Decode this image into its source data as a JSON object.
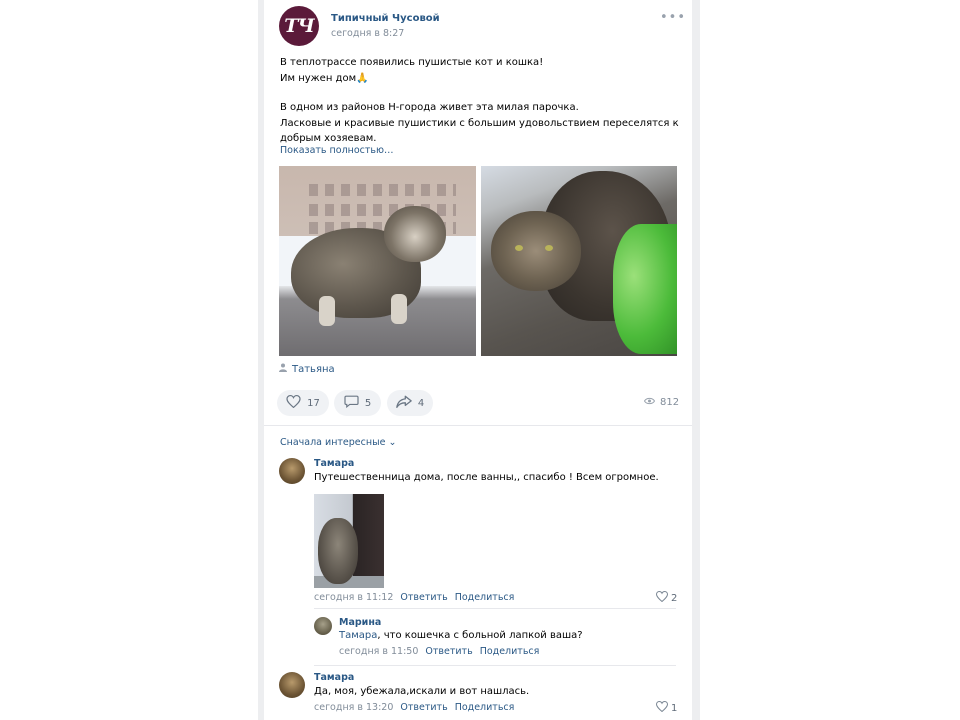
{
  "group": {
    "avatar_text": "ТЧ",
    "name": "Типичный Чусовой",
    "time": "сегодня в 8:27",
    "more": "•••"
  },
  "post": {
    "line1": "В теплотрассе появились пушистые кот и кошка!",
    "line2": "Им нужен дом🙏",
    "line3": "В одном из районов Н-города живет эта милая парочка.",
    "line4": "Ласковые и красивые пушистики с большим удовольствием переселятся к",
    "line5": "добрым хозяевам.",
    "show_more": "Показать полностью…",
    "author": "Татьяна"
  },
  "actions": {
    "likes": "17",
    "comments": "5",
    "shares": "4",
    "views": "812"
  },
  "comments_sort": "Сначала интересные ⌄",
  "comments": [
    {
      "author": "Тамара",
      "text": "Путешественница дома, после ванны,, спасибо ! Всем огромное.",
      "time": "сегодня в 11:12",
      "reply": "Ответить",
      "share": "Поделиться",
      "likes": "2"
    },
    {
      "author": "Марина",
      "reply_to": "Тамара",
      "text": ", что кошечка с больной лапкой ваша?",
      "time": "сегодня в 11:50",
      "reply": "Ответить",
      "share": "Поделиться"
    },
    {
      "author": "Тамара",
      "text": "Да, моя, убежала,искали и вот нашлась.",
      "time": "сегодня в 13:20",
      "reply": "Ответить",
      "share": "Поделиться",
      "likes": "1"
    }
  ],
  "icons": {
    "like": "heart-icon",
    "comment": "comment-bubble-icon",
    "share": "share-arrow-icon",
    "views": "eye-icon",
    "user": "user-icon"
  },
  "colors": {
    "link": "#2a5885",
    "meta": "#818c99",
    "button_bg": "#f0f2f5",
    "avatar_bg": "#5b1a3a"
  }
}
